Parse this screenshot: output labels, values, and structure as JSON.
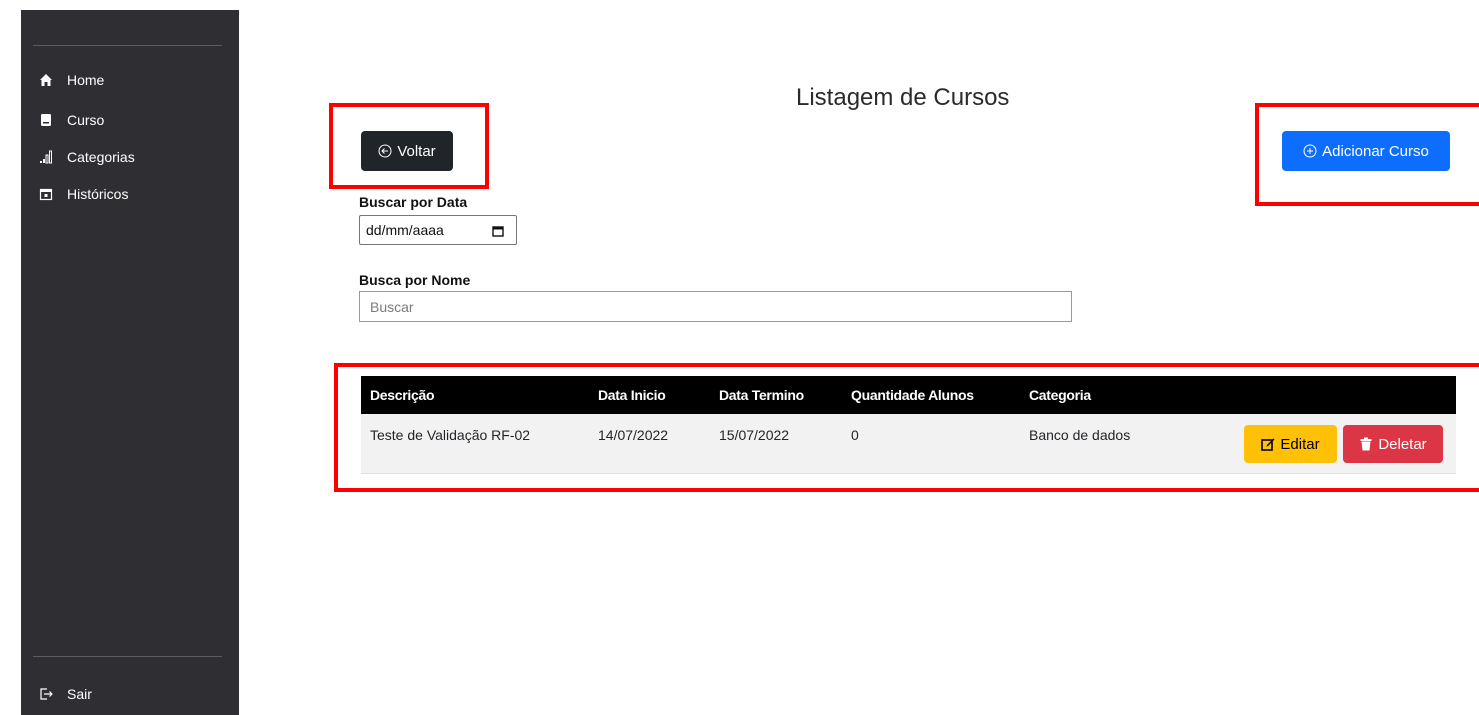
{
  "sidebar": {
    "items": [
      {
        "label": "Home",
        "icon": "home-icon"
      },
      {
        "label": "Curso",
        "icon": "book-icon"
      },
      {
        "label": "Categorias",
        "icon": "bar-chart-icon"
      },
      {
        "label": "Históricos",
        "icon": "calendar-icon"
      }
    ],
    "logout": {
      "label": "Sair",
      "icon": "logout-icon"
    }
  },
  "header": {
    "title": "Listagem de Cursos",
    "back_label": "Voltar",
    "add_label": "Adicionar Curso"
  },
  "filters": {
    "date_label": "Buscar por Data",
    "date_value": "dd/mm/aaaa",
    "name_label": "Busca por Nome",
    "name_placeholder": "Buscar"
  },
  "table": {
    "columns": [
      "Descrição",
      "Data Inicio",
      "Data Termino",
      "Quantidade Alunos",
      "Categoria"
    ],
    "rows": [
      {
        "descricao": "Teste de Validação RF-02",
        "data_inicio": "14/07/2022",
        "data_termino": "15/07/2022",
        "quantidade_alunos": "0",
        "categoria": "Banco de dados"
      }
    ],
    "edit_label": "Editar",
    "delete_label": "Deletar"
  },
  "colors": {
    "sidebar_bg": "#2f2f33",
    "primary": "#0d6efd",
    "dark": "#212529",
    "warning": "#ffc107",
    "danger": "#dc3545",
    "highlight": "#ff0000"
  }
}
